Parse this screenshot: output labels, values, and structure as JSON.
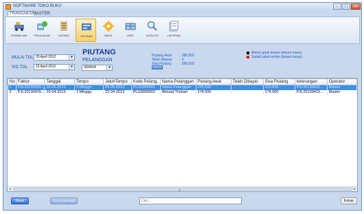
{
  "window": {
    "title": "SOFTWARE TOKO BUKU"
  },
  "menu": [
    "TRANSAKSI",
    "MASTER"
  ],
  "ribbon": [
    {
      "label": "PEMBELIAN",
      "icon": "purchase-icon",
      "active": false
    },
    {
      "label": "PENJUALAN",
      "icon": "sales-icon",
      "active": false
    },
    {
      "label": "HUTANG",
      "icon": "debt-icon",
      "active": false
    },
    {
      "label": "PIUTANG",
      "icon": "receivable-icon",
      "active": true
    },
    {
      "label": "BIAYA",
      "icon": "gear-icon",
      "active": false
    },
    {
      "label": "GRID",
      "icon": "grid-icon",
      "active": false
    },
    {
      "label": "KATALOG",
      "icon": "search-icon",
      "active": false
    },
    {
      "label": "LAPORAN",
      "icon": "report-icon",
      "active": false
    }
  ],
  "filter": {
    "mulai_label": "MULAI TGL",
    "mulai_value": "20 April 2012",
    "sd_label": "S/D TGL",
    "sd_value": "15 April 2013",
    "semua_value": "SEMUA"
  },
  "heading": "PIUTANG",
  "subheading": "PELANGGAN",
  "summary": [
    {
      "label": "Piutang Awal",
      "value": ": 289,500"
    },
    {
      "label": "Telah dibayar",
      "value": ": 0"
    },
    {
      "label": "Sisa Piutang",
      "value": ": 289,500"
    }
  ],
  "legend": [
    {
      "color": "#000000",
      "text": "Belum jatuh tempo (belum lunas)"
    },
    {
      "color": "#e01010",
      "text": "Sudah jatuh tempo (belum lunas)"
    }
  ],
  "table": {
    "columns": [
      "No",
      "Faktur",
      "Tanggal",
      "Tempo",
      "JatuhTempo",
      "Kode Pelang..",
      "Nama Pelanggan",
      "Piutang Awal",
      "Telah Dibayar",
      "Sisa Piutang",
      "keterangan",
      "Operator"
    ],
    "rows": [
      [
        "1",
        "PJL20130415...",
        "15-05-2013",
        "3 Minggu",
        "05-05-2013",
        "PLG0000001",
        "Nama Pelanggan",
        "225,500",
        "",
        "225,500",
        "PJL20130415...",
        "Master"
      ],
      [
        "2",
        "PJL20130415...",
        "15-04-2013",
        "1 Minggu",
        "22-04-2013",
        "PLG0000002",
        "Ahmad Thohari",
        "174,000",
        "",
        "174,000",
        "PJL20130415...",
        "Master"
      ]
    ],
    "selected_row": 0
  },
  "buttons": {
    "bayar": "Bayar",
    "hapus": "Hapus Keterangan",
    "keluar": "Keluar"
  },
  "search": {
    "placeholder": "Cari..."
  }
}
